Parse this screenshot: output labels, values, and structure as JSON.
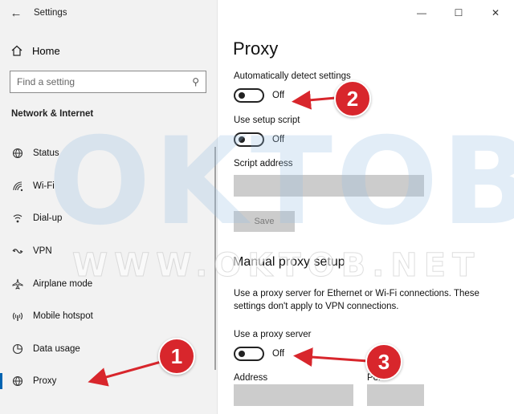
{
  "window": {
    "title": "Settings",
    "controls": {
      "minimize": "—",
      "maximize": "☐",
      "close": "✕"
    }
  },
  "sidebar": {
    "back_icon": "back-arrow-icon",
    "home_label": "Home",
    "search_placeholder": "Find a setting",
    "section_title": "Network & Internet",
    "items": [
      {
        "label": "Status",
        "icon": "globe-status-icon"
      },
      {
        "label": "Wi-Fi",
        "icon": "wifi-icon"
      },
      {
        "label": "Dial-up",
        "icon": "dialup-icon"
      },
      {
        "label": "VPN",
        "icon": "vpn-icon"
      },
      {
        "label": "Airplane mode",
        "icon": "airplane-icon"
      },
      {
        "label": "Mobile hotspot",
        "icon": "hotspot-icon"
      },
      {
        "label": "Data usage",
        "icon": "data-usage-icon"
      },
      {
        "label": "Proxy",
        "icon": "globe-icon",
        "active": true
      }
    ]
  },
  "main": {
    "title": "Proxy",
    "auto_detect_label": "Automatically detect settings",
    "auto_detect_state": "Off",
    "setup_script_label": "Use setup script",
    "setup_script_state": "Off",
    "script_address_label": "Script address",
    "script_address_value": "",
    "save_label": "Save",
    "manual_title": "Manual proxy setup",
    "manual_desc": "Use a proxy server for Ethernet or Wi-Fi connections. These settings don't apply to VPN connections.",
    "use_proxy_label": "Use a proxy server",
    "use_proxy_state": "Off",
    "address_label": "Address",
    "address_value": "",
    "port_label": "Port",
    "port_value": ""
  },
  "annotations": {
    "badge1": "1",
    "badge2": "2",
    "badge3": "3",
    "color": "#d8262c"
  },
  "watermark": {
    "big": "OKTOB",
    "url": "WWW.OKTOB.NET"
  }
}
